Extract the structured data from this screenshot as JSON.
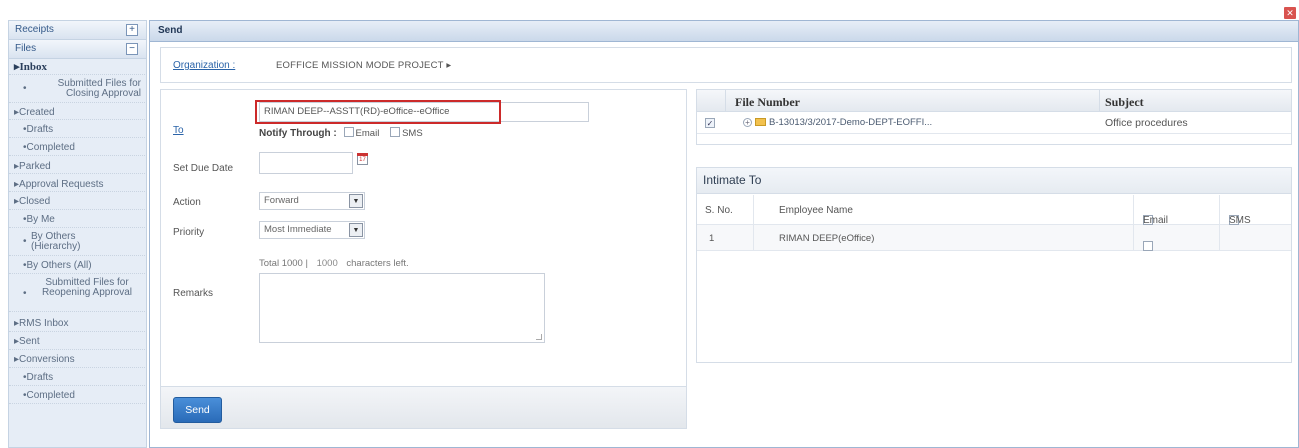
{
  "sidebar": {
    "receipts_header": "Receipts",
    "files_header": "Files",
    "items": [
      {
        "label": "Inbox"
      },
      {
        "label": "Submitted Files for Closing Approval"
      },
      {
        "label": "Created"
      },
      {
        "label": "Drafts"
      },
      {
        "label": "Completed"
      },
      {
        "label": "Parked"
      },
      {
        "label": "Approval Requests"
      },
      {
        "label": "Closed"
      },
      {
        "label": "By Me"
      },
      {
        "label": "By Others (Hierarchy)"
      },
      {
        "label": "By Others (All)"
      },
      {
        "label": "Submitted Files for Reopening Approval"
      },
      {
        "label": "RMS Inbox"
      },
      {
        "label": "Sent"
      },
      {
        "label": "Conversions"
      },
      {
        "label": "Drafts"
      },
      {
        "label": "Completed"
      }
    ]
  },
  "window": {
    "title": "Send"
  },
  "organization": {
    "label": "Organization :",
    "value": "EOFFICE MISSION MODE PROJECT"
  },
  "form": {
    "to_label": "To",
    "to_value": "RIMAN DEEP--ASSTT(RD)-eOffice--eOffice",
    "notify_label": "Notify Through :",
    "notify_email": "Email",
    "notify_sms": "SMS",
    "due_date_label": "Set Due Date",
    "calendar_text": "17",
    "action_label": "Action",
    "action_value": "Forward",
    "priority_label": "Priority",
    "priority_value": "Most Immediate",
    "total_text": "Total 1000 |",
    "chars_count": "1000",
    "chars_suffix": "characters left.",
    "remarks_label": "Remarks",
    "send_label": "Send"
  },
  "file_table": {
    "col_file": "File Number",
    "col_subject": "Subject",
    "rows": [
      {
        "file_number": "B-13013/3/2017-Demo-DEPT-EOFFI...",
        "subject": "Office procedures"
      }
    ]
  },
  "intimate": {
    "title": "Intimate To",
    "col_sno": "S. No.",
    "col_name": "Employee Name",
    "col_email": "Email",
    "col_sms": "SMS",
    "rows": [
      {
        "sno": "1",
        "name": "RIMAN DEEP(eOffice)"
      }
    ]
  }
}
